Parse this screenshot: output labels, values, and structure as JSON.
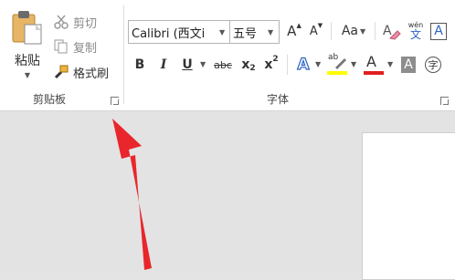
{
  "clipboard": {
    "paste_label": "粘贴",
    "cut_label": "剪切",
    "copy_label": "复制",
    "format_painter_label": "格式刷",
    "group_label": "剪贴板"
  },
  "font": {
    "font_name": "Calibri (西文i",
    "font_size": "五号",
    "change_case_label": "Aa",
    "phonetic_top": "wén",
    "phonetic_bottom": "文",
    "group_label": "字体",
    "bold": "B",
    "italic": "I",
    "underline": "U",
    "strike": "abc",
    "subscript_main": "x",
    "subscript_sub": "2",
    "superscript_main": "x",
    "superscript_sup": "2",
    "text_effects": "A",
    "highlight_text": "ab",
    "font_color": "A",
    "char_shading": "A",
    "enclose_char": "字",
    "grow_font": "A",
    "shrink_font": "A",
    "border_A": "A",
    "clear_format": "A"
  },
  "colors": {
    "highlight": "#ffff00",
    "font_color": "#e02020",
    "arrow": "#e8262b",
    "accent_blue": "#2b63c6"
  }
}
